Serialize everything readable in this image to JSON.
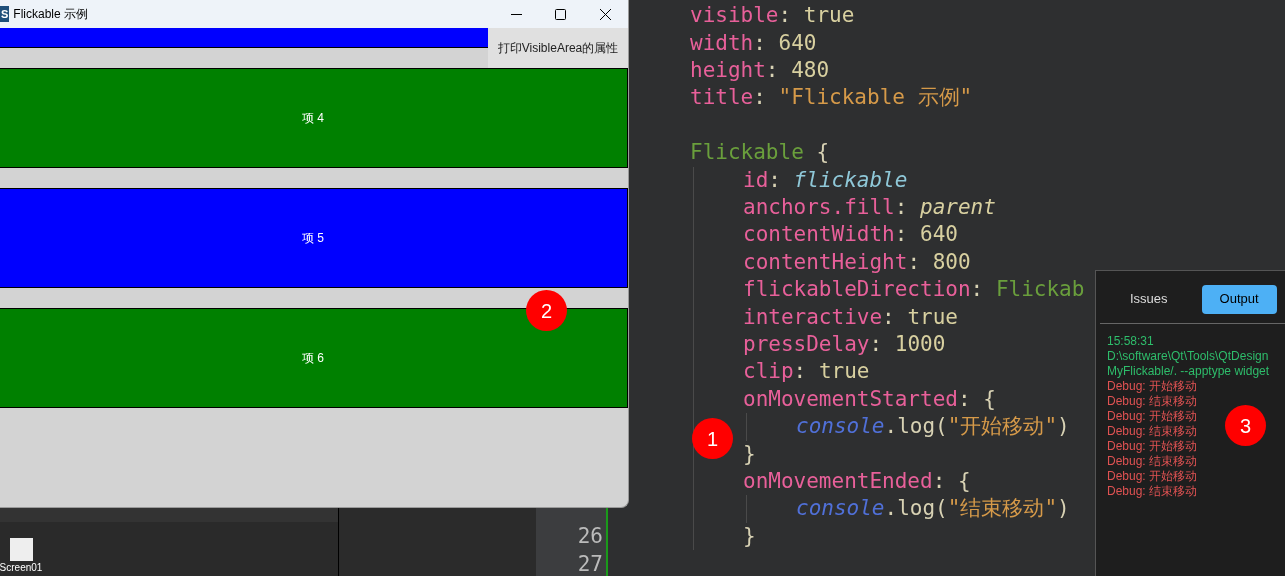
{
  "ide": {
    "components": [
      {
        "label": "Screen01"
      }
    ],
    "gutter": [
      {
        "number": "26",
        "current": false
      },
      {
        "number": "27",
        "current": false
      }
    ],
    "code": [
      {
        "kind": "code",
        "tokens": [
          {
            "text": "visible",
            "kind": "key"
          },
          {
            "text": ": ",
            "kind": "punct"
          },
          {
            "text": "true",
            "kind": "value"
          }
        ]
      },
      {
        "kind": "code",
        "tokens": [
          {
            "text": "width",
            "kind": "key"
          },
          {
            "text": ": ",
            "kind": "punct"
          },
          {
            "text": "640",
            "kind": "value"
          }
        ]
      },
      {
        "kind": "code",
        "tokens": [
          {
            "text": "height",
            "kind": "key"
          },
          {
            "text": ": ",
            "kind": "punct"
          },
          {
            "text": "480",
            "kind": "value"
          }
        ]
      },
      {
        "kind": "code",
        "tokens": [
          {
            "text": "title",
            "kind": "key"
          },
          {
            "text": ": ",
            "kind": "punct"
          },
          {
            "text": "\"Flickable 示例\"",
            "kind": "string"
          }
        ]
      },
      {
        "kind": "blank"
      },
      {
        "kind": "code",
        "tokens": [
          {
            "text": "Flickable",
            "kind": "type"
          },
          {
            "text": " {",
            "kind": "punct"
          }
        ],
        "children": [
          {
            "kind": "code",
            "tokens": [
              {
                "text": "id",
                "kind": "key"
              },
              {
                "text": ": ",
                "kind": "punct"
              },
              {
                "text": "flickable",
                "kind": "id"
              }
            ]
          },
          {
            "kind": "code",
            "tokens": [
              {
                "text": "anchors.fill",
                "kind": "key"
              },
              {
                "text": ": ",
                "kind": "punct"
              },
              {
                "text": "parent",
                "kind": "ref"
              }
            ]
          },
          {
            "kind": "code",
            "tokens": [
              {
                "text": "contentWidth",
                "kind": "key"
              },
              {
                "text": ": ",
                "kind": "punct"
              },
              {
                "text": "640",
                "kind": "value"
              }
            ]
          },
          {
            "kind": "code",
            "tokens": [
              {
                "text": "contentHeight",
                "kind": "key"
              },
              {
                "text": ": ",
                "kind": "punct"
              },
              {
                "text": "800",
                "kind": "value"
              }
            ]
          },
          {
            "kind": "code",
            "tokens": [
              {
                "text": "flickableDirection",
                "kind": "key"
              },
              {
                "text": ": ",
                "kind": "punct"
              },
              {
                "text": "Flickab",
                "kind": "type"
              }
            ]
          },
          {
            "kind": "code",
            "tokens": [
              {
                "text": "interactive",
                "kind": "key"
              },
              {
                "text": ": ",
                "kind": "punct"
              },
              {
                "text": "true",
                "kind": "value"
              }
            ]
          },
          {
            "kind": "code",
            "tokens": [
              {
                "text": "pressDelay",
                "kind": "key"
              },
              {
                "text": ": ",
                "kind": "punct"
              },
              {
                "text": "1000",
                "kind": "value"
              }
            ]
          },
          {
            "kind": "code",
            "tokens": [
              {
                "text": "clip",
                "kind": "key"
              },
              {
                "text": ": ",
                "kind": "punct"
              },
              {
                "text": "true",
                "kind": "value"
              }
            ]
          },
          {
            "kind": "code",
            "tokens": [
              {
                "text": "onMovementStarted",
                "kind": "key"
              },
              {
                "text": ": {",
                "kind": "punct"
              }
            ],
            "children": [
              {
                "kind": "code",
                "tokens": [
                  {
                    "text": "console",
                    "kind": "object"
                  },
                  {
                    "text": ".log(",
                    "kind": "punct"
                  },
                  {
                    "text": "\"开始移动\"",
                    "kind": "string"
                  },
                  {
                    "text": ")",
                    "kind": "punct"
                  }
                ]
              }
            ]
          },
          {
            "kind": "code",
            "tokens": [
              {
                "text": "}",
                "kind": "punct"
              }
            ]
          },
          {
            "kind": "code",
            "tokens": [
              {
                "text": "onMovementEnded",
                "kind": "key"
              },
              {
                "text": ": {",
                "kind": "punct"
              }
            ],
            "children": [
              {
                "kind": "code",
                "tokens": [
                  {
                    "text": "console",
                    "kind": "object"
                  },
                  {
                    "text": ".log(",
                    "kind": "punct"
                  },
                  {
                    "text": "\"结束移动\"",
                    "kind": "string"
                  },
                  {
                    "text": ")",
                    "kind": "punct"
                  }
                ]
              }
            ]
          },
          {
            "kind": "code",
            "tokens": [
              {
                "text": "}",
                "kind": "punct"
              }
            ]
          }
        ]
      }
    ],
    "output": {
      "tabs": [
        {
          "label": "Issues",
          "selected": false
        },
        {
          "label": "Output",
          "selected": true
        }
      ],
      "lines": [
        {
          "text": "15:58:31",
          "kind": "info"
        },
        {
          "text": "D:\\software\\Qt\\Tools\\QtDesign",
          "kind": "info"
        },
        {
          "text": "MyFlickable/. --apptype widget",
          "kind": "info"
        },
        {
          "text": "Debug: 开始移动",
          "kind": "debug"
        },
        {
          "text": "Debug: 结束移动",
          "kind": "debug"
        },
        {
          "text": "Debug: 开始移动",
          "kind": "debug"
        },
        {
          "text": "Debug: 结束移动",
          "kind": "debug"
        },
        {
          "text": "Debug: 开始移动",
          "kind": "debug"
        },
        {
          "text": "Debug: 结束移动",
          "kind": "debug"
        },
        {
          "text": "Debug: 开始移动",
          "kind": "debug"
        },
        {
          "text": "Debug: 结束移动",
          "kind": "debug"
        }
      ]
    }
  },
  "app_window": {
    "icon_text": "S",
    "title": "Flickable 示例",
    "button": "打印VisibleArea的属性",
    "items": [
      {
        "label": "项 4",
        "color": "#008000"
      },
      {
        "label": "项 5",
        "color": "#0000ff"
      },
      {
        "label": "项 6",
        "color": "#008000"
      }
    ]
  },
  "annotations": [
    {
      "label": "1"
    },
    {
      "label": "2"
    },
    {
      "label": "3"
    }
  ]
}
